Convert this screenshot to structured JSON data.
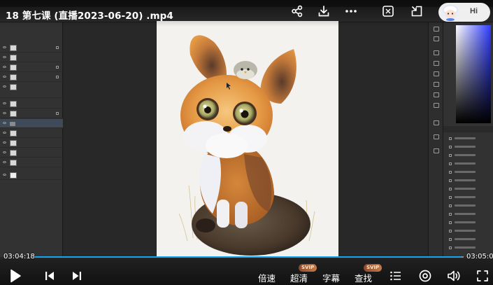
{
  "video": {
    "title": "18 第七课 (直播2023-06-20) .mp4",
    "time_current": "03:04:18",
    "time_total": "03:05:08",
    "progress_fraction": 0.993
  },
  "assistant": {
    "label": "Hi"
  },
  "top_actions": {
    "share_icon": "share-icon",
    "download_icon": "download-icon",
    "more_icon": "more-dots-icon",
    "screenshot_icon": "screenshot-icon",
    "window_icon": "pip-window-icon"
  },
  "controls": {
    "speed_label": "倍速",
    "quality_label": "超清",
    "subtitle_label": "字幕",
    "search_label": "查找",
    "quality_badge": "SVIP",
    "search_badge": "SVIP"
  },
  "colors": {
    "progress_accent": "#18a3ee",
    "svip_badge": "#b06a3c"
  }
}
